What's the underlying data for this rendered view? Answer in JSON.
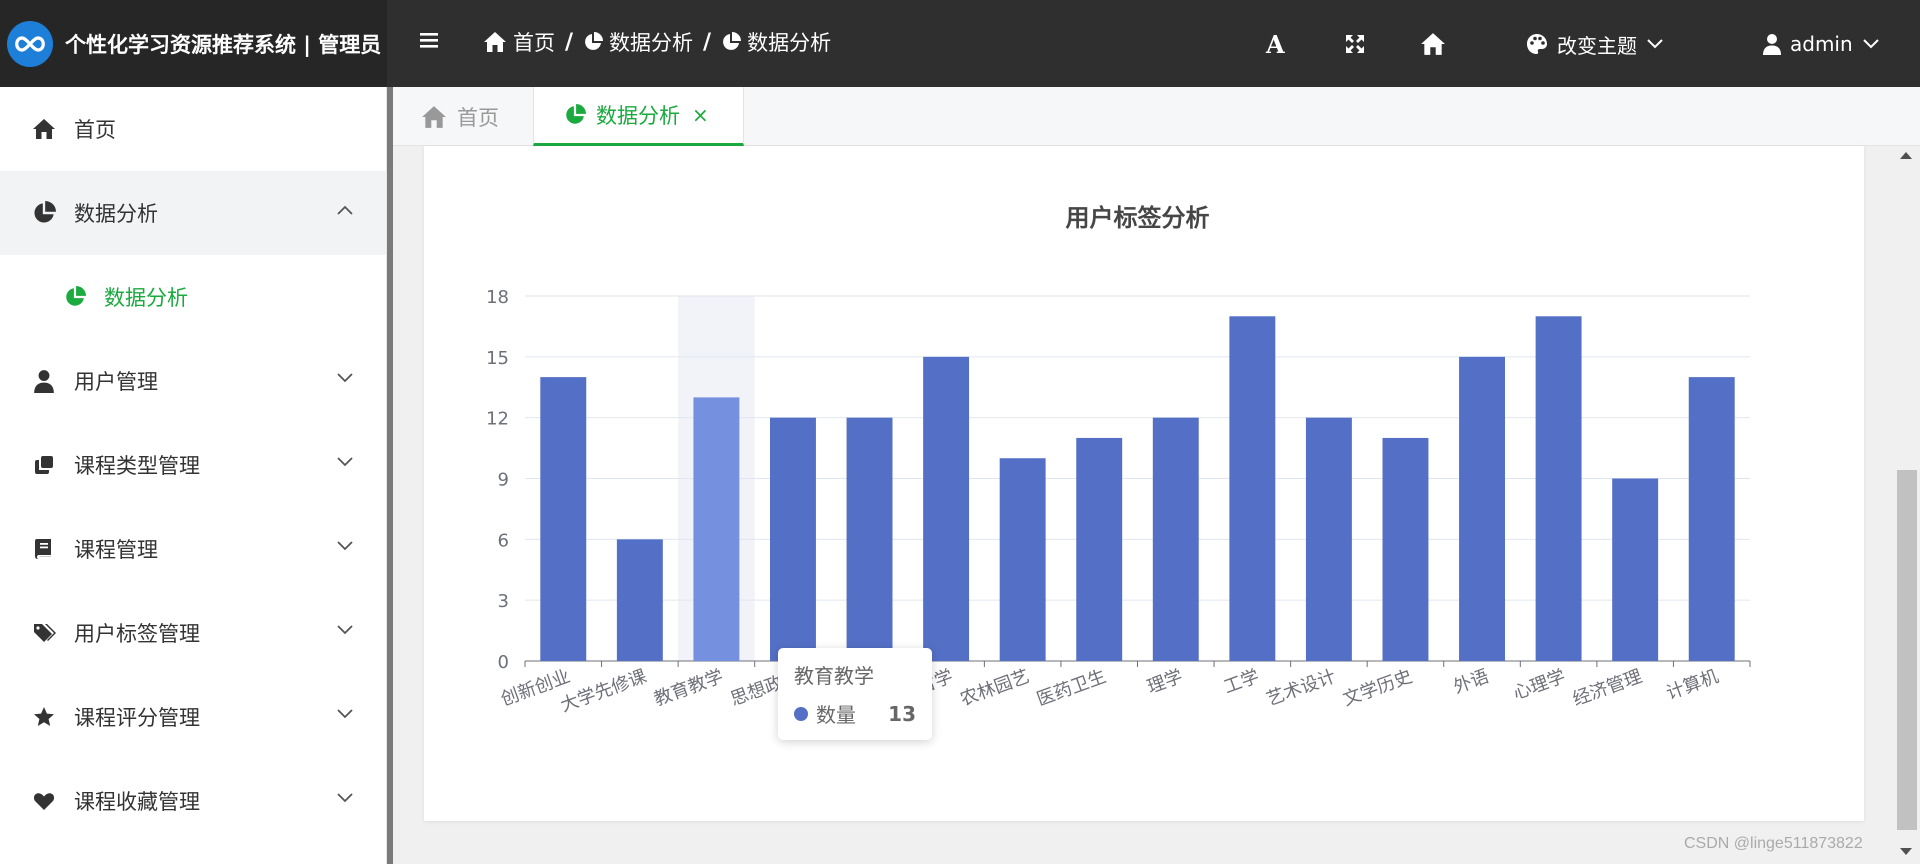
{
  "app": {
    "title": "个性化学习资源推荐系统 | 管理员"
  },
  "breadcrumb": [
    {
      "label": "首页",
      "icon": "home-icon"
    },
    {
      "label": "数据分析",
      "icon": "pie-chart-icon"
    },
    {
      "label": "数据分析",
      "icon": "pie-chart-icon"
    }
  ],
  "breadcrumb_separator": "/",
  "header": {
    "font_btn_label": "A",
    "theme_label": "改变主题",
    "user_label": "admin"
  },
  "sidebar": {
    "items": [
      {
        "label": "首页",
        "icon": "home-icon"
      },
      {
        "label": "数据分析",
        "icon": "pie-chart-icon",
        "expanded": true,
        "children": [
          {
            "label": "数据分析",
            "active": true
          }
        ]
      },
      {
        "label": "用户管理",
        "icon": "user-icon"
      },
      {
        "label": "课程类型管理",
        "icon": "clone-icon"
      },
      {
        "label": "课程管理",
        "icon": "book-icon"
      },
      {
        "label": "用户标签管理",
        "icon": "tags-icon"
      },
      {
        "label": "课程评分管理",
        "icon": "star-icon"
      },
      {
        "label": "课程收藏管理",
        "icon": "heart-icon"
      }
    ]
  },
  "tabs": [
    {
      "label": "首页",
      "icon": "home-icon",
      "active": false
    },
    {
      "label": "数据分析",
      "icon": "pie-chart-icon",
      "active": true,
      "close": "×"
    }
  ],
  "watermark": "CSDN @linge511873822",
  "colors": {
    "bar": "#5470c6",
    "bar_highlight": "#7590df",
    "accent": "#1aaa3e",
    "header": "#2f2f2f"
  },
  "chart_data": {
    "type": "bar",
    "title": "用户标签分析",
    "categories": [
      "创新创业",
      "大学先修课",
      "教育教学",
      "思想政治",
      "",
      "哲学",
      "农林园艺",
      "医药卫生",
      "理学",
      "工学",
      "艺术设计",
      "文学历史",
      "外语",
      "心理学",
      "经济管理",
      "计算机"
    ],
    "series": [
      {
        "name": "数量",
        "values": [
          14,
          6,
          13,
          12,
          12,
          15,
          10,
          11,
          12,
          17,
          12,
          11,
          15,
          17,
          9,
          14
        ]
      }
    ],
    "ylim": [
      0,
      18
    ],
    "yticks": [
      0,
      3,
      6,
      9,
      12,
      15,
      18
    ],
    "grid": true,
    "highlight_index": 2,
    "tooltip": {
      "title": "教育教学",
      "series": "数量",
      "value": "13"
    }
  }
}
